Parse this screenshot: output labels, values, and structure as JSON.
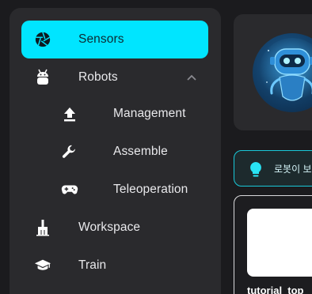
{
  "sidebar": {
    "items": [
      {
        "label": "Sensors",
        "icon": "aperture-icon",
        "active": true
      },
      {
        "label": "Robots",
        "icon": "android-icon",
        "expanded": true
      },
      {
        "label": "Management",
        "icon": "upload-icon"
      },
      {
        "label": "Assemble",
        "icon": "wrench-icon"
      },
      {
        "label": "Teleoperation",
        "icon": "gamepad-icon"
      },
      {
        "label": "Workspace",
        "icon": "broom-icon"
      },
      {
        "label": "Train",
        "icon": "graduation-cap-icon"
      }
    ]
  },
  "tip": {
    "text": "로봇이 보"
  },
  "file_card": {
    "name": "tutorial_top"
  },
  "colors": {
    "accent": "#00e5ff",
    "sidebar_bg": "#2a2a2d",
    "page_bg": "#1b1b1e"
  }
}
